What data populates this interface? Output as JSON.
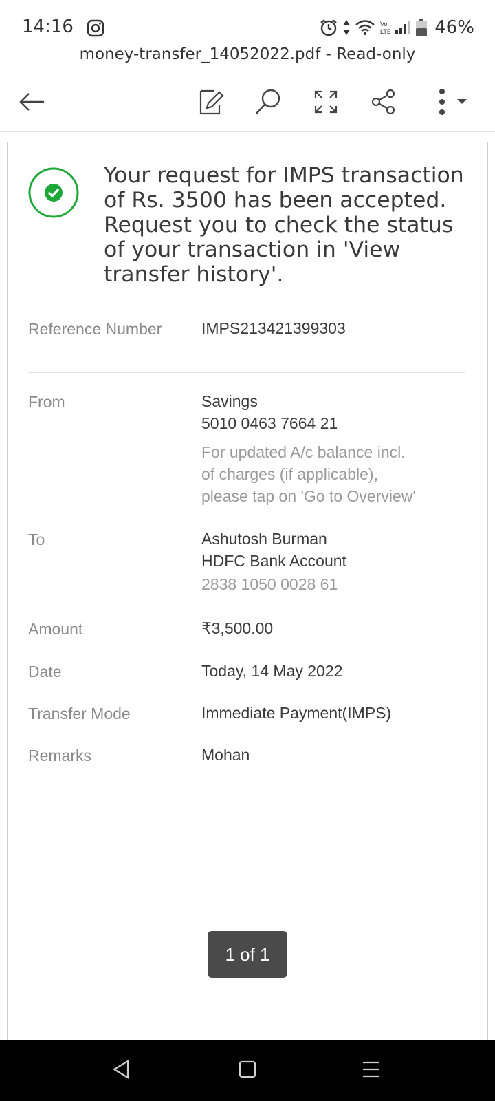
{
  "status_bar": {
    "time": "14:16",
    "battery_percent": "46%",
    "icons": [
      "instagram-icon",
      "alarm-icon",
      "data-arrows-icon",
      "wifi-icon",
      "volte-icon",
      "signal-icon",
      "battery-icon"
    ]
  },
  "document": {
    "title": "money-transfer_14052022.pdf - Read-only"
  },
  "toolbar": {
    "icons": [
      "back-arrow-icon",
      "edit-icon",
      "search-icon",
      "fullscreen-icon",
      "share-icon",
      "more-icon"
    ]
  },
  "receipt": {
    "message": "Your request for IMPS transaction of Rs. 3500 has been accepted. Request you to check the status of your transaction in 'View transfer history'.",
    "reference": {
      "label": "Reference Number",
      "value": "IMPS213421399303"
    },
    "from": {
      "label": "From",
      "account_type": "Savings",
      "account_number": "5010 0463 7664 21",
      "note_lines": [
        "For updated A/c balance incl.",
        "of charges (if applicable),",
        "please tap on 'Go to Overview'"
      ]
    },
    "to": {
      "label": "To",
      "name": "Ashutosh Burman",
      "bank": "HDFC Bank Account",
      "account_number": "2838 1050 0028 61"
    },
    "amount": {
      "label": "Amount",
      "value": "₹3,500.00"
    },
    "date": {
      "label": "Date",
      "value": "Today, 14 May 2022"
    },
    "mode": {
      "label": "Transfer Mode",
      "value": "Immediate Payment(IMPS)"
    },
    "remarks": {
      "label": "Remarks",
      "value": "Mohan"
    }
  },
  "page_indicator": "1 of 1",
  "colors": {
    "success_green": "#1fa83a",
    "label_gray": "#8a8a8a",
    "indicator_bg": "#4a4a4a"
  }
}
